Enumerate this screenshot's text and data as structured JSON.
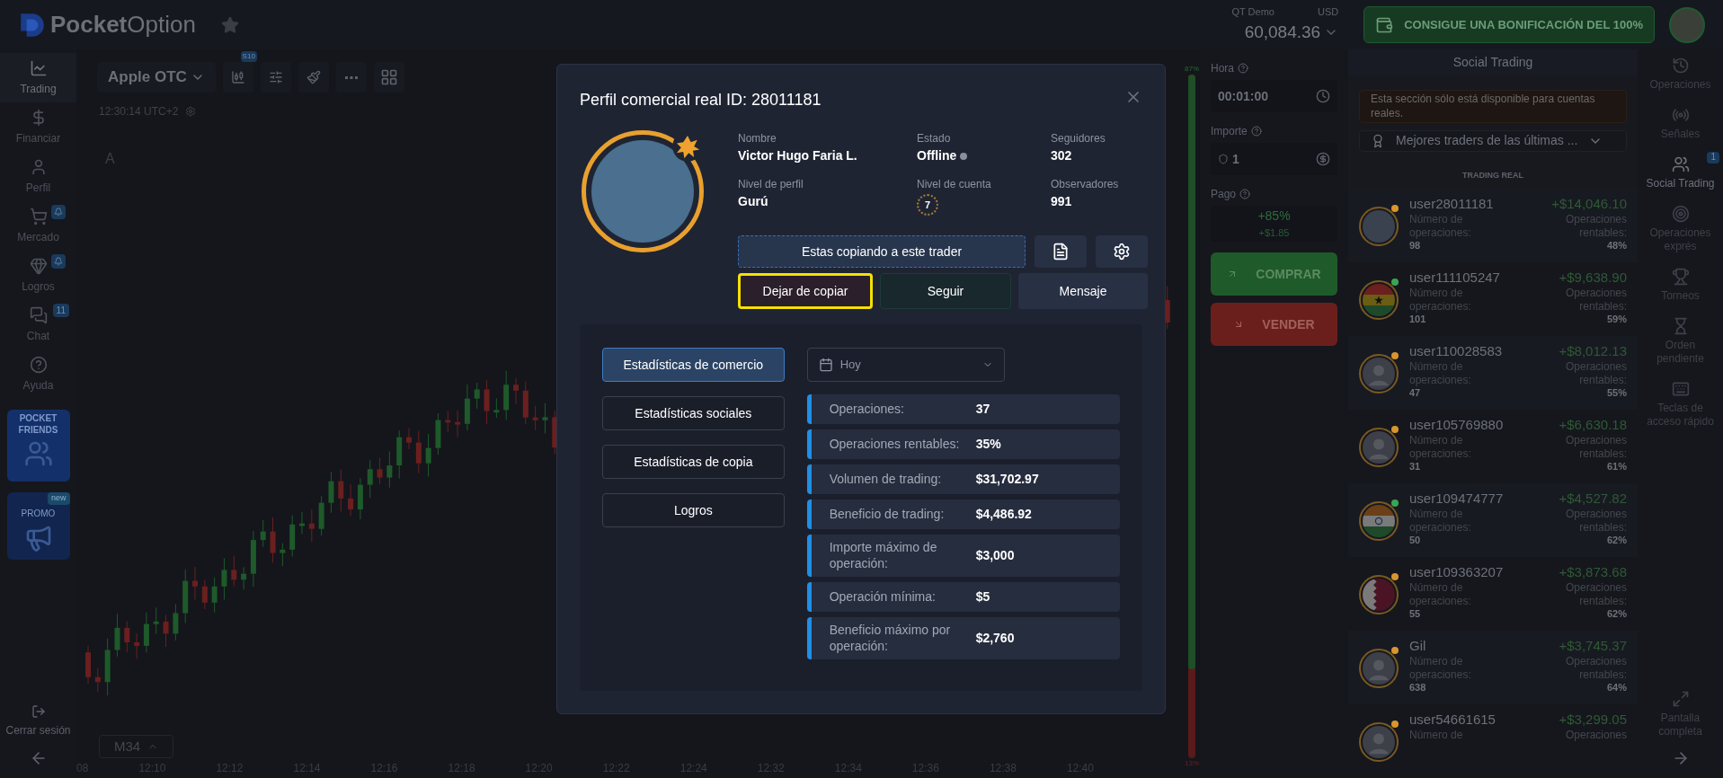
{
  "top_bar": {
    "logo_bold": "Pocket",
    "logo_light": "Option",
    "account_label": "QT Demo",
    "currency": "USD",
    "balance": "60,084.36",
    "bonus_button": "CONSIGUE UNA BONIFICACIÓN DEL 100%"
  },
  "left_sidebar": {
    "items": [
      {
        "kind": "trading",
        "label": "Trading",
        "selected": true
      },
      {
        "kind": "finance",
        "label": "Financiar",
        "selected": false
      },
      {
        "kind": "profile",
        "label": "Perfil",
        "selected": false
      },
      {
        "kind": "market",
        "label": "Mercado",
        "selected": false,
        "bell": true
      },
      {
        "kind": "achievements",
        "label": "Logros",
        "selected": false,
        "bell": true
      },
      {
        "kind": "chat",
        "label": "Chat",
        "selected": false,
        "badge": "11"
      },
      {
        "kind": "help",
        "label": "Ayuda",
        "selected": false
      }
    ],
    "friends_card": "POCKET FRIENDS",
    "promo_card": "PROMO",
    "promo_badge": "new",
    "logout": "Cerrar sesión"
  },
  "chart": {
    "asset": "Apple OTC",
    "chart_type_badge": "S10",
    "time": "12:30:14 UTC+2",
    "tool_letter": "A",
    "timeframe": "M34",
    "x_labels": [
      "08",
      "12:10",
      "12:12",
      "12:14",
      "12:16",
      "12:18",
      "12:20",
      "12:22",
      "12:24",
      "12:32",
      "12:34",
      "12:36",
      "12:38",
      "12:40"
    ],
    "sentiment_up": "87%",
    "sentiment_down": "13%",
    "level": 0.87
  },
  "trade_panel": {
    "time_label": "Hora",
    "time_value": "00:01:00",
    "amount_label": "Importe",
    "amount_value": "1",
    "payout_label": "Pago",
    "payout_percent": "+85%",
    "payout_amount": "+$1.85",
    "buy": "COMPRAR",
    "sell": "VENDER"
  },
  "social_trading": {
    "title": "Social Trading",
    "notice": "Esta sección sólo está disponible para cuentas reales.",
    "filter": "Mejores traders de las últimas ...",
    "section": "TRADING REAL",
    "traders": [
      {
        "name": "user28011181",
        "count_label": "Número de operaciones:",
        "count": "98",
        "profit": "+$14,046.10",
        "rate_label": "Operaciones rentables:",
        "rate": "48%",
        "kind": "photo",
        "color": "#d9952e"
      },
      {
        "name": "user111105247",
        "count_label": "Número de operaciones:",
        "count": "101",
        "profit": "+$9,638.90",
        "rate_label": "Operaciones rentables:",
        "rate": "59%",
        "kind": "ghana",
        "color": "#3aa655"
      },
      {
        "name": "user110028583",
        "count_label": "Número de operaciones:",
        "count": "47",
        "profit": "+$8,012.13",
        "rate_label": "Operaciones rentables:",
        "rate": "55%",
        "kind": "default",
        "color": "#d9952e"
      },
      {
        "name": "user105769880",
        "count_label": "Número de operaciones:",
        "count": "31",
        "profit": "+$6,630.18",
        "rate_label": "Operaciones rentables:",
        "rate": "61%",
        "kind": "default",
        "color": "#d9952e"
      },
      {
        "name": "user109474777",
        "count_label": "Número de operaciones:",
        "count": "50",
        "profit": "+$4,527.82",
        "rate_label": "Operaciones rentables:",
        "rate": "62%",
        "kind": "india",
        "color": "#3aa655"
      },
      {
        "name": "user109363207",
        "count_label": "Número de operaciones:",
        "count": "55",
        "profit": "+$3,873.68",
        "rate_label": "Operaciones rentables:",
        "rate": "62%",
        "kind": "qatar",
        "color": "#d9952e"
      },
      {
        "name": "Gil",
        "count_label": "Número de operaciones:",
        "count": "638",
        "profit": "+$3,745.37",
        "rate_label": "Operaciones rentables:",
        "rate": "64%",
        "kind": "default",
        "color": "#d9952e"
      },
      {
        "name": "user54661615",
        "count_label": "Número de",
        "profit": "+$3,299.05",
        "rate_label": "Operaciones",
        "kind": "default",
        "color": "#d9952e"
      }
    ]
  },
  "right_sidebar": {
    "items": [
      {
        "kind": "history",
        "label": "Operaciones",
        "selected": false
      },
      {
        "kind": "signals",
        "label": "Señales",
        "selected": false
      },
      {
        "kind": "social",
        "label": "Social Trading",
        "selected": true,
        "badge": "1"
      },
      {
        "kind": "express",
        "label": "Operaciones exprés",
        "selected": false
      },
      {
        "kind": "tournaments",
        "label": "Torneos",
        "selected": false
      },
      {
        "kind": "pending",
        "label": "Orden pendiente",
        "selected": false
      },
      {
        "kind": "hotkeys",
        "label": "Teclas de acceso rápido",
        "selected": false
      }
    ],
    "fullscreen": "Pantalla completa"
  },
  "modal": {
    "title": "Perfil comercial real ID: 28011181",
    "fields": [
      {
        "label": "Nombre",
        "value": "Victor Hugo Faria L."
      },
      {
        "label": "Estado",
        "value": "Offline",
        "kind": "status"
      },
      {
        "label": "Seguidores",
        "value": "302"
      },
      {
        "label": "Nivel de perfil",
        "value": "Gurú"
      },
      {
        "label": "Nivel de cuenta",
        "value": "7",
        "kind": "level"
      },
      {
        "label": "Observadores",
        "value": "991"
      }
    ],
    "copy_status": "Estas copiando a este trader",
    "actions": [
      {
        "label": "Dejar de copiar",
        "kind": "stop",
        "highlighted": true
      },
      {
        "label": "Seguir",
        "kind": "follow",
        "highlighted": false
      },
      {
        "label": "Mensaje",
        "kind": "message",
        "highlighted": false
      }
    ],
    "tabs": [
      {
        "label": "Estadísticas de comercio",
        "selected": true
      },
      {
        "label": "Estadísticas sociales",
        "selected": false
      },
      {
        "label": "Estadísticas de copia",
        "selected": false
      },
      {
        "label": "Logros",
        "selected": false
      }
    ],
    "period": "Hoy",
    "stats": [
      {
        "label": "Operaciones:",
        "value": "37"
      },
      {
        "label": "Operaciones rentables:",
        "value": "35%"
      },
      {
        "label": "Volumen de trading:",
        "value": "$31,702.97"
      },
      {
        "label": "Beneficio de trading:",
        "value": "$4,486.92"
      },
      {
        "label": "Importe máximo de operación:",
        "value": "$3,000"
      },
      {
        "label": "Operación mínima:",
        "value": "$5"
      },
      {
        "label": "Beneficio máximo por operación:",
        "value": "$2,760"
      }
    ]
  }
}
